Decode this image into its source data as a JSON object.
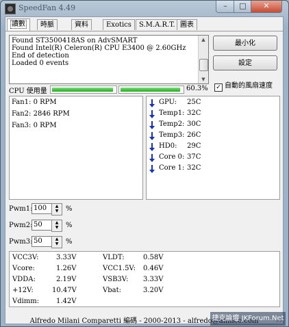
{
  "window": {
    "title": "SpeedFan 4.49"
  },
  "titlebar": {
    "minimize_glyph": "–",
    "maximize_glyph": "□",
    "close_glyph": "✕"
  },
  "tabs": [
    {
      "label": "讀數"
    },
    {
      "label": "時脈"
    },
    {
      "label": "資料"
    },
    {
      "label": "Exotics"
    },
    {
      "label": "S.M.A.R.T."
    },
    {
      "label": "圖表"
    }
  ],
  "log": {
    "lines": [
      "Found ST3500418AS on AdvSMART",
      "Found Intel(R) Celeron(R) CPU E3400 @ 2.60GHz",
      "End of detection",
      "Loaded 0 events"
    ]
  },
  "buttons": {
    "minimize": "最小化",
    "settings": "設定"
  },
  "auto_fan": {
    "label": "自動的風扇速度",
    "checked": true,
    "check_glyph": "✓"
  },
  "cpu": {
    "label": "CPU 使用量",
    "core1": 0.97,
    "core2": 0.97,
    "percent_text": "60.3%"
  },
  "fans": [
    {
      "label": "Fan1:",
      "value": "0 RPM"
    },
    {
      "label": "Fan2:",
      "value": "2846 RPM"
    },
    {
      "label": "Fan3:",
      "value": "0 RPM"
    }
  ],
  "temps": [
    {
      "label": "GPU:",
      "value": "25C"
    },
    {
      "label": "Temp1:",
      "value": "32C"
    },
    {
      "label": "Temp2:",
      "value": "30C"
    },
    {
      "label": "Temp3:",
      "value": "26C"
    },
    {
      "label": "HD0:",
      "value": "29C"
    },
    {
      "label": "Core 0:",
      "value": "37C"
    },
    {
      "label": "Core 1:",
      "value": "32C"
    }
  ],
  "pwm": [
    {
      "label": "Pwm1:",
      "value": "100",
      "unit": "%"
    },
    {
      "label": "Pwm2:",
      "value": "50",
      "unit": "%"
    },
    {
      "label": "Pwm3:",
      "value": "50",
      "unit": "%"
    }
  ],
  "voltages_left": [
    {
      "label": "VCC3V:",
      "value": "3.33V"
    },
    {
      "label": "Vcore:",
      "value": "1.26V"
    },
    {
      "label": "VDDA:",
      "value": "2.19V"
    },
    {
      "label": "+12V:",
      "value": "10.47V"
    },
    {
      "label": "Vdimm:",
      "value": "1.42V"
    }
  ],
  "voltages_right": [
    {
      "label": "VLDT:",
      "value": "0.58V"
    },
    {
      "label": "VCC1.5V:",
      "value": "0.46V"
    },
    {
      "label": "VSB3V:",
      "value": "3.33V"
    },
    {
      "label": "Vbat:",
      "value": "3.20V"
    }
  ],
  "footer": "Alfredo Milani Comparetti 編碼 - 2000-2013 - alfredo@almico.com",
  "watermark": "捷克論壇 JKForum.Net",
  "colors": {
    "accent_green": "#1fae1f",
    "arrow_blue": "#1530c8"
  }
}
